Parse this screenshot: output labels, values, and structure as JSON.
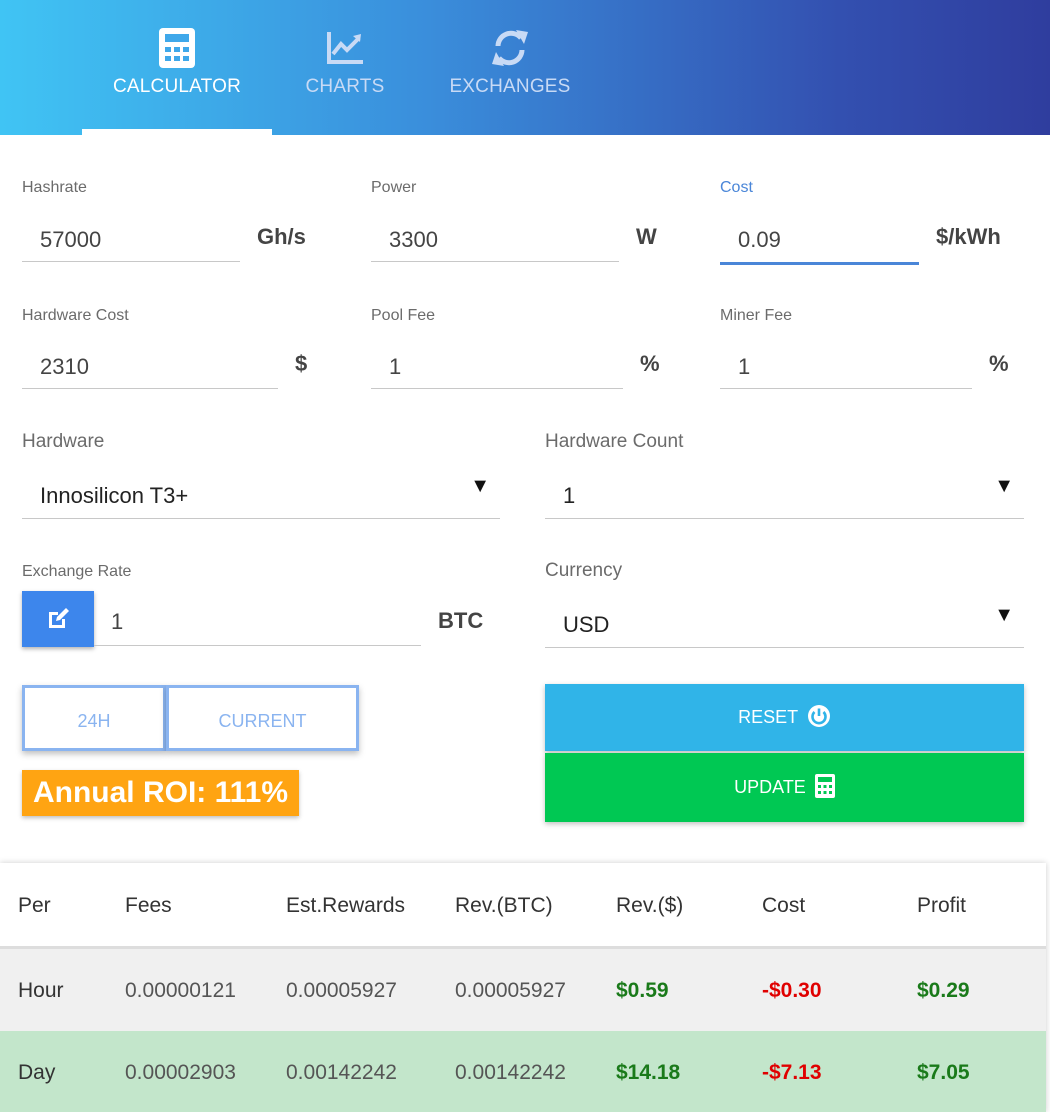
{
  "tabs": [
    {
      "label": "CALCULATOR",
      "icon": "calculator-icon",
      "active": true
    },
    {
      "label": "CHARTS",
      "icon": "chart-icon",
      "active": false
    },
    {
      "label": "EXCHANGES",
      "icon": "exchange-icon",
      "active": false
    }
  ],
  "fields": {
    "hashrate": {
      "label": "Hashrate",
      "value": "57000",
      "unit": "Gh/s"
    },
    "power": {
      "label": "Power",
      "value": "3300",
      "unit": "W"
    },
    "cost": {
      "label": "Cost",
      "value": "0.09",
      "unit": "$/kWh"
    },
    "hardware_cost": {
      "label": "Hardware Cost",
      "value": "2310",
      "unit": "$"
    },
    "pool_fee": {
      "label": "Pool Fee",
      "value": "1",
      "unit": "%"
    },
    "miner_fee": {
      "label": "Miner Fee",
      "value": "1",
      "unit": "%"
    },
    "exchange_rate": {
      "label": "Exchange Rate",
      "value": "1",
      "unit": "BTC"
    }
  },
  "selects": {
    "hardware": {
      "label": "Hardware",
      "value": "Innosilicon T3+"
    },
    "hardware_count": {
      "label": "Hardware Count",
      "value": "1"
    },
    "currency": {
      "label": "Currency",
      "value": "USD"
    }
  },
  "rate_toggle": {
    "option_24h": "24H",
    "option_current": "CURRENT"
  },
  "roi": {
    "text": "Annual ROI: 111%"
  },
  "buttons": {
    "reset": "RESET",
    "update": "UPDATE"
  },
  "table": {
    "headers": [
      "Per",
      "Fees",
      "Est.Rewards",
      "Rev.(BTC)",
      "Rev.($)",
      "Cost",
      "Profit"
    ],
    "rows": [
      {
        "per": "Hour",
        "fees": "0.00000121",
        "rewards": "0.00005927",
        "rev_btc": "0.00005927",
        "rev_usd": "$0.59",
        "cost": "-$0.30",
        "profit": "$0.29"
      },
      {
        "per": "Day",
        "fees": "0.00002903",
        "rewards": "0.00142242",
        "rev_btc": "0.00142242",
        "rev_usd": "$14.18",
        "cost": "-$7.13",
        "profit": "$7.05"
      }
    ]
  },
  "colors": {
    "accent": "#4a86d8",
    "reset": "#30b4e8",
    "update": "#00c853",
    "roi": "#ffa412",
    "positive": "#1a7a1a",
    "negative": "#e00000"
  }
}
